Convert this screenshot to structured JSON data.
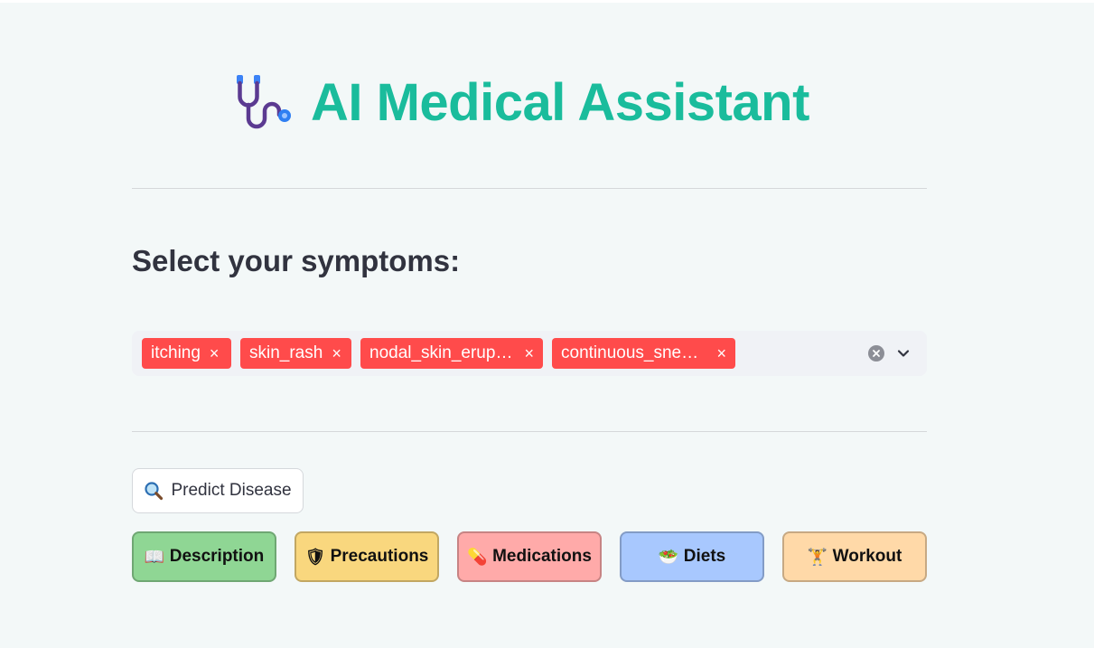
{
  "app": {
    "title": "AI Medical Assistant",
    "icon": "stethoscope-icon",
    "accent_color": "#1abc9c"
  },
  "symptoms": {
    "label": "Select your symptoms:",
    "selected": [
      "itching",
      "skin_rash",
      "nodal_skin_erup…",
      "continuous_sne…"
    ],
    "chip_color": "#ff4b4b",
    "remove_glyph": "×"
  },
  "predict": {
    "label": "Predict Disease",
    "icon": "magnifier-icon"
  },
  "actions": [
    {
      "label": "Description",
      "icon": "book-icon",
      "glyph": "📖",
      "color": "#8fd694"
    },
    {
      "label": "Precautions",
      "icon": "shield-icon",
      "glyph": "🛡",
      "color": "#f9d77e"
    },
    {
      "label": "Medications",
      "icon": "pill-icon",
      "glyph": "💊",
      "color": "#ffaaa9"
    },
    {
      "label": "Diets",
      "icon": "salad-icon",
      "glyph": "🥗",
      "color": "#a8c8fe"
    },
    {
      "label": "Workout",
      "icon": "weightlifter-icon",
      "glyph": "🏋",
      "color": "#ffd9a8"
    }
  ]
}
